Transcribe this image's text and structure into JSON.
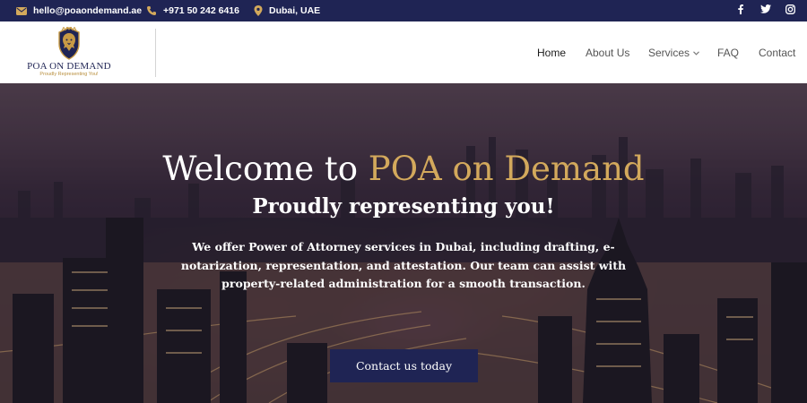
{
  "topbar": {
    "email": "hello@poaondemand.ae",
    "phone": "+971 50 242 6416",
    "location": "Dubai, UAE",
    "icons": [
      "envelope-icon",
      "phone-icon",
      "location-pin-icon"
    ],
    "social": [
      "facebook-icon",
      "twitter-icon",
      "instagram-icon"
    ]
  },
  "header": {
    "logo_name": "POA ON DEMAND",
    "logo_tagline": "Proudly Representing You!",
    "logo_icon": "lion-crest-icon",
    "nav": [
      {
        "label": "Home",
        "active": true
      },
      {
        "label": "About Us"
      },
      {
        "label": "Services",
        "has_dropdown": true
      },
      {
        "label": "FAQ"
      },
      {
        "label": "Contact"
      }
    ]
  },
  "hero": {
    "title_prefix": "Welcome to",
    "title_accent": "POA on Demand",
    "subtitle": "Proudly representing you!",
    "description": "We offer Power of Attorney services in Dubai, including drafting, e-notarization, representation, and attestation. Our team can assist with property-related administration for a smooth transaction.",
    "cta_label": "Contact us today",
    "background": "night-city-skyline-image"
  },
  "colors": {
    "navy": "#1f2454",
    "gold": "#d3a95c",
    "white": "#ffffff"
  }
}
